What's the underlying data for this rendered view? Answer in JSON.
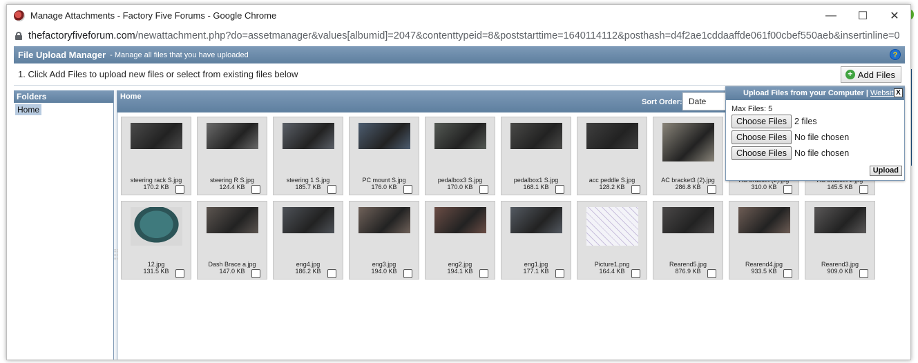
{
  "window": {
    "title": "Manage Attachments - Factory Five Forums - Google Chrome",
    "minimize": "—",
    "maximize": "☐",
    "close": "✕"
  },
  "address": {
    "host": "thefactoryfiveforum.com",
    "path": "/newattachment.php?do=assetmanager&values[albumid]=2047&contenttypeid=8&poststarttime=1640114112&posthash=d4f2ae1cddaaffde061f00cbef550aeb&insertinline=0"
  },
  "manager": {
    "title": "File Upload Manager",
    "subtitle": "- Manage all files that you have uploaded",
    "help_glyph": "?",
    "instruction": "1. Click Add Files to upload new files or select from existing files below",
    "add_files_label": "Add Files",
    "folders_header": "Folders",
    "folder_home": "Home",
    "main_header": "Home",
    "sort_label": "Sort Order:",
    "sort_value": "Date"
  },
  "files": [
    {
      "name": "steering rack S.jpg",
      "size": "170.2 KB",
      "color": "#4b4b4b"
    },
    {
      "name": "steering R S.jpg",
      "size": "124.4 KB",
      "color": "#6a6a6a"
    },
    {
      "name": "steering 1 S.jpg",
      "size": "185.7 KB",
      "color": "#5b6068"
    },
    {
      "name": "PC mount S.jpg",
      "size": "176.0 KB",
      "color": "#4d5d70"
    },
    {
      "name": "pedalbox3 S.jpg",
      "size": "170.0 KB",
      "color": "#555a55"
    },
    {
      "name": "pedalbox1 S.jpg",
      "size": "168.1 KB",
      "color": "#4a4a48"
    },
    {
      "name": "acc peddle S.jpg",
      "size": "128.2 KB",
      "color": "#3f3f3f"
    },
    {
      "name": "AC bracket3 (2).jpg",
      "size": "286.8 KB",
      "color": "#8a857a"
    },
    {
      "name": "AC bracket (2).jpg",
      "size": "310.0 KB",
      "color": "#777"
    },
    {
      "name": "AC bracket 2.jpg",
      "size": "145.5 KB",
      "color": "#777"
    },
    {
      "name": "12.jpg",
      "size": "131.5 KB",
      "color": "#3e6f73"
    },
    {
      "name": "Dash Brace a.jpg",
      "size": "147.0 KB",
      "color": "#5c5550"
    },
    {
      "name": "eng4.jpg",
      "size": "186.2 KB",
      "color": "#4e5258"
    },
    {
      "name": "eng3.jpg",
      "size": "194.0 KB",
      "color": "#70625a"
    },
    {
      "name": "eng2.jpg",
      "size": "194.1 KB",
      "color": "#6b4d45"
    },
    {
      "name": "eng1.jpg",
      "size": "177.1 KB",
      "color": "#545a62"
    },
    {
      "name": "Picture1.png",
      "size": "164.4 KB",
      "color": "#e8e8f0"
    },
    {
      "name": "Rearend5.jpg",
      "size": "876.9 KB",
      "color": "#4a4848"
    },
    {
      "name": "Rearend4.jpg",
      "size": "933.5 KB",
      "color": "#6e5d55"
    },
    {
      "name": "Rearend3.jpg",
      "size": "909.0 KB",
      "color": "#5a5858"
    }
  ],
  "upload": {
    "header": "Upload Files from your Computer",
    "sep": "|",
    "website": "Website",
    "close": "X",
    "max_files": "Max Files: 5",
    "rows": [
      {
        "button": "Choose Files",
        "status": "2 files"
      },
      {
        "button": "Choose Files",
        "status": "No file chosen"
      },
      {
        "button": "Choose Files",
        "status": "No file chosen"
      }
    ],
    "upload_label": "Upload"
  }
}
